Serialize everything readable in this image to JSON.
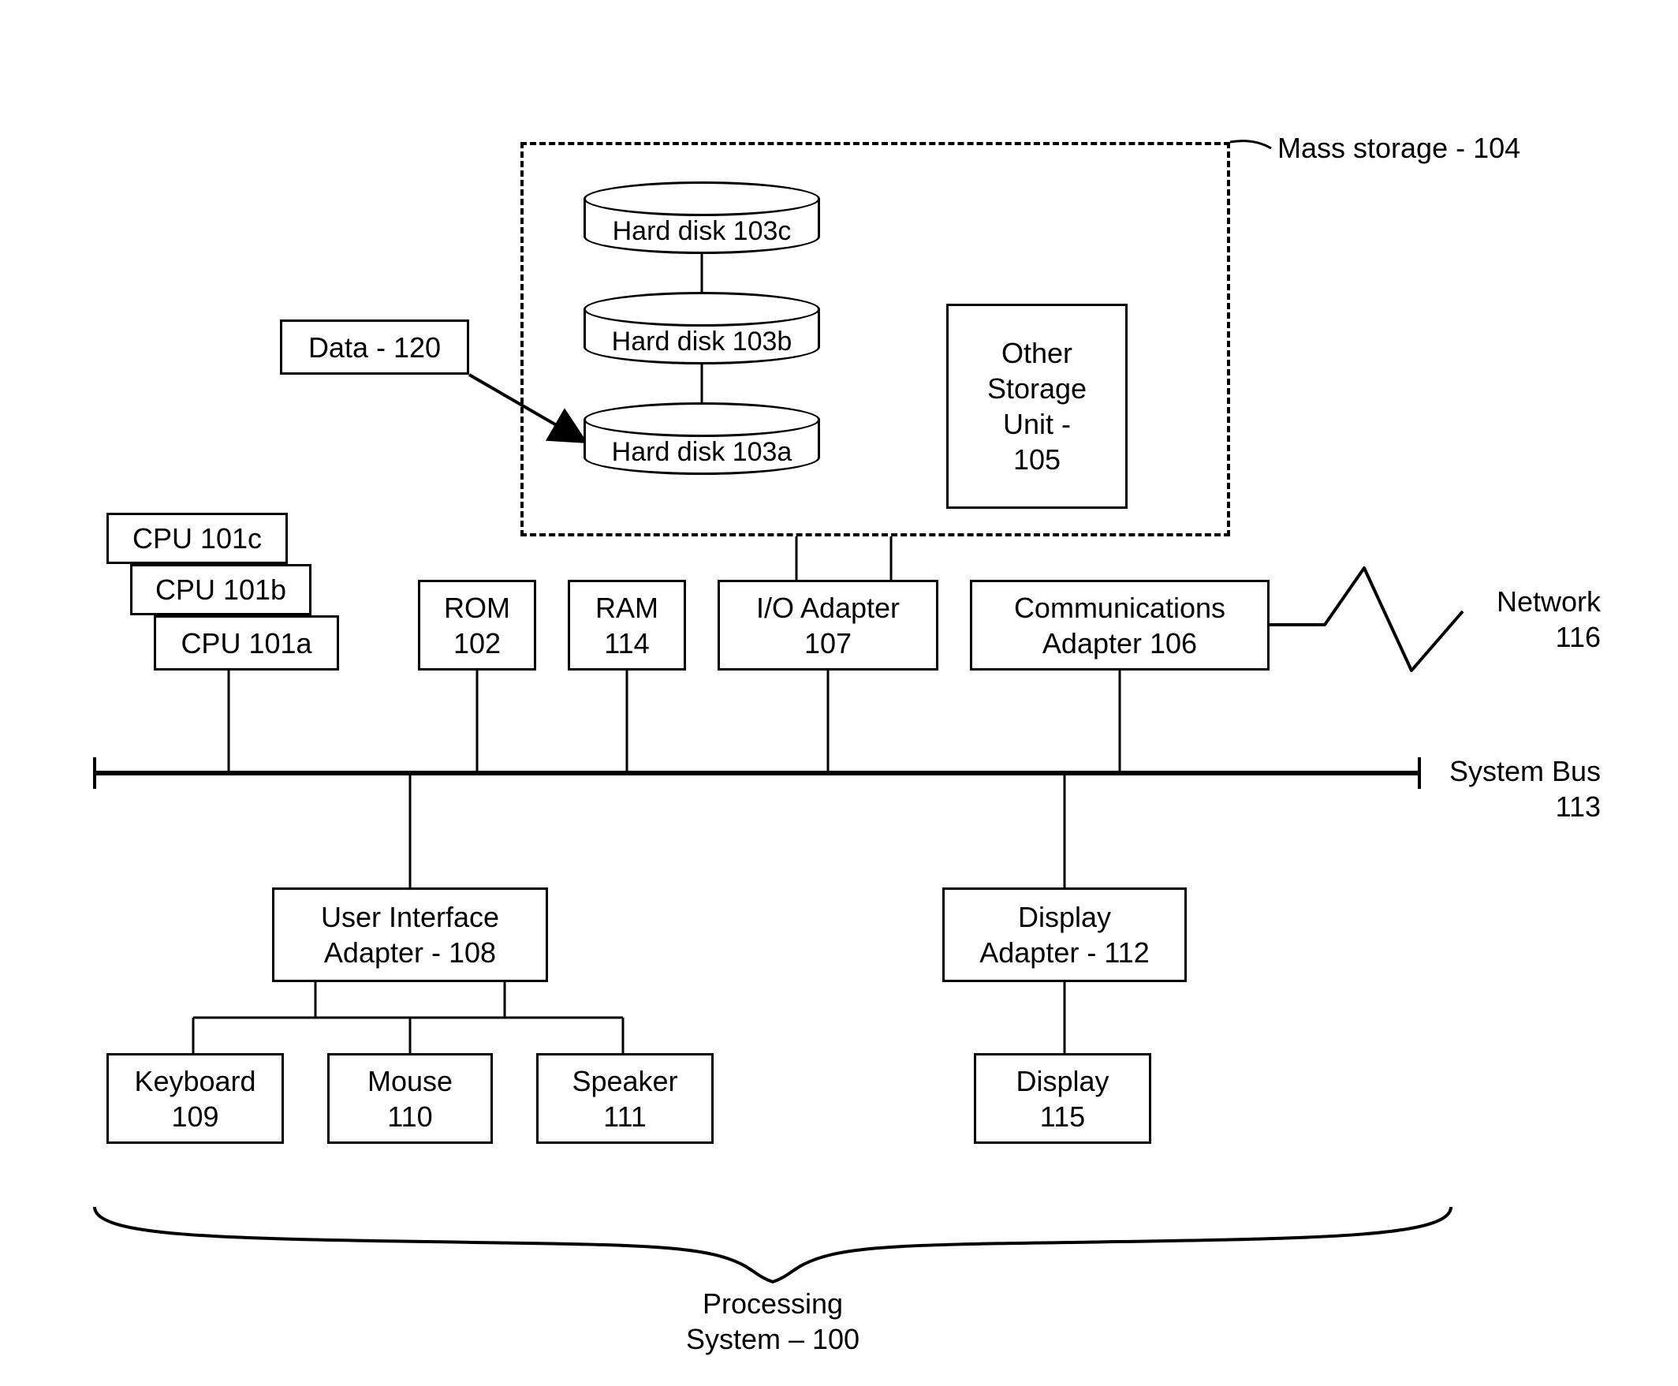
{
  "massStorage": {
    "label": "Mass storage - 104",
    "disks": {
      "c": "Hard disk 103c",
      "b": "Hard disk 103b",
      "a": "Hard disk 103a"
    },
    "otherStorage": "Other\nStorage\nUnit -\n105"
  },
  "dataLabel": "Data - 120",
  "cpus": {
    "c": "CPU 101c",
    "b": "CPU 101b",
    "a": "CPU 101a"
  },
  "rom": "ROM\n102",
  "ram": "RAM\n114",
  "ioAdapter": "I/O Adapter\n107",
  "commAdapter": "Communications\nAdapter 106",
  "network": "Network\n116",
  "systemBus": "System Bus\n113",
  "uiAdapter": "User Interface\nAdapter - 108",
  "displayAdapter": "Display\nAdapter - 112",
  "keyboard": "Keyboard\n109",
  "mouse": "Mouse\n110",
  "speaker": "Speaker\n111",
  "display": "Display\n115",
  "caption": "Processing\nSystem – 100"
}
